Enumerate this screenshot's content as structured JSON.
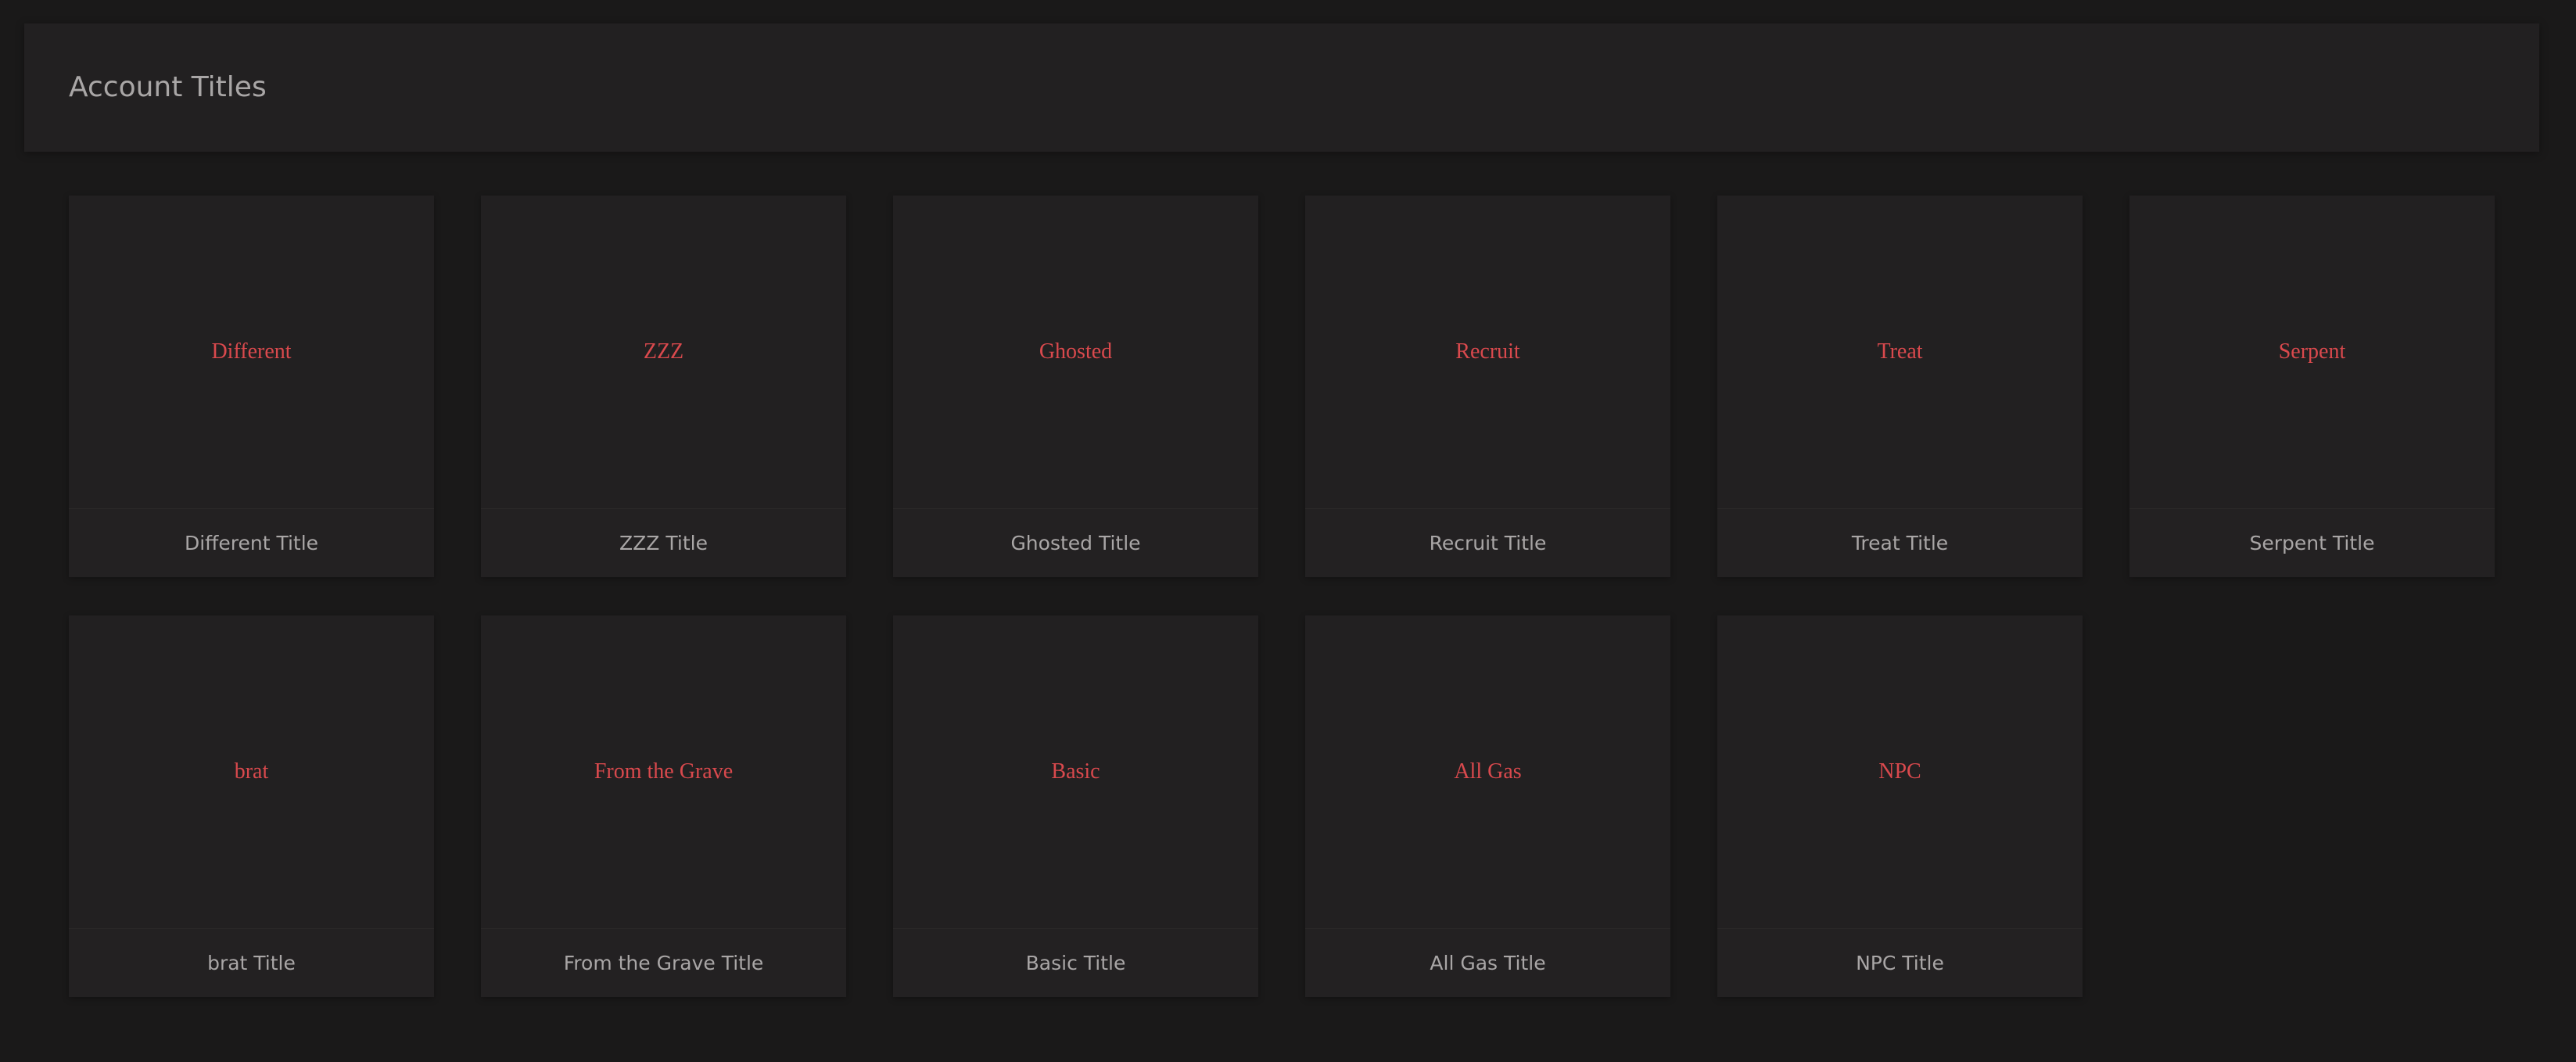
{
  "header": {
    "title": "Account Titles"
  },
  "colors": {
    "background": "#1a1919",
    "panel": "#222021",
    "preview_text": "#d9494d",
    "label_text": "#a9a6a6"
  },
  "titles": [
    {
      "preview": "Different",
      "label": "Different Title"
    },
    {
      "preview": "ZZZ",
      "label": "ZZZ Title"
    },
    {
      "preview": "Ghosted",
      "label": "Ghosted Title"
    },
    {
      "preview": "Recruit",
      "label": "Recruit Title"
    },
    {
      "preview": "Treat",
      "label": "Treat Title"
    },
    {
      "preview": "Serpent",
      "label": "Serpent Title"
    },
    {
      "preview": "brat",
      "label": "brat Title"
    },
    {
      "preview": "From the Grave",
      "label": "From the Grave Title"
    },
    {
      "preview": "Basic",
      "label": "Basic Title"
    },
    {
      "preview": "All Gas",
      "label": "All Gas Title"
    },
    {
      "preview": "NPC",
      "label": "NPC Title"
    }
  ]
}
